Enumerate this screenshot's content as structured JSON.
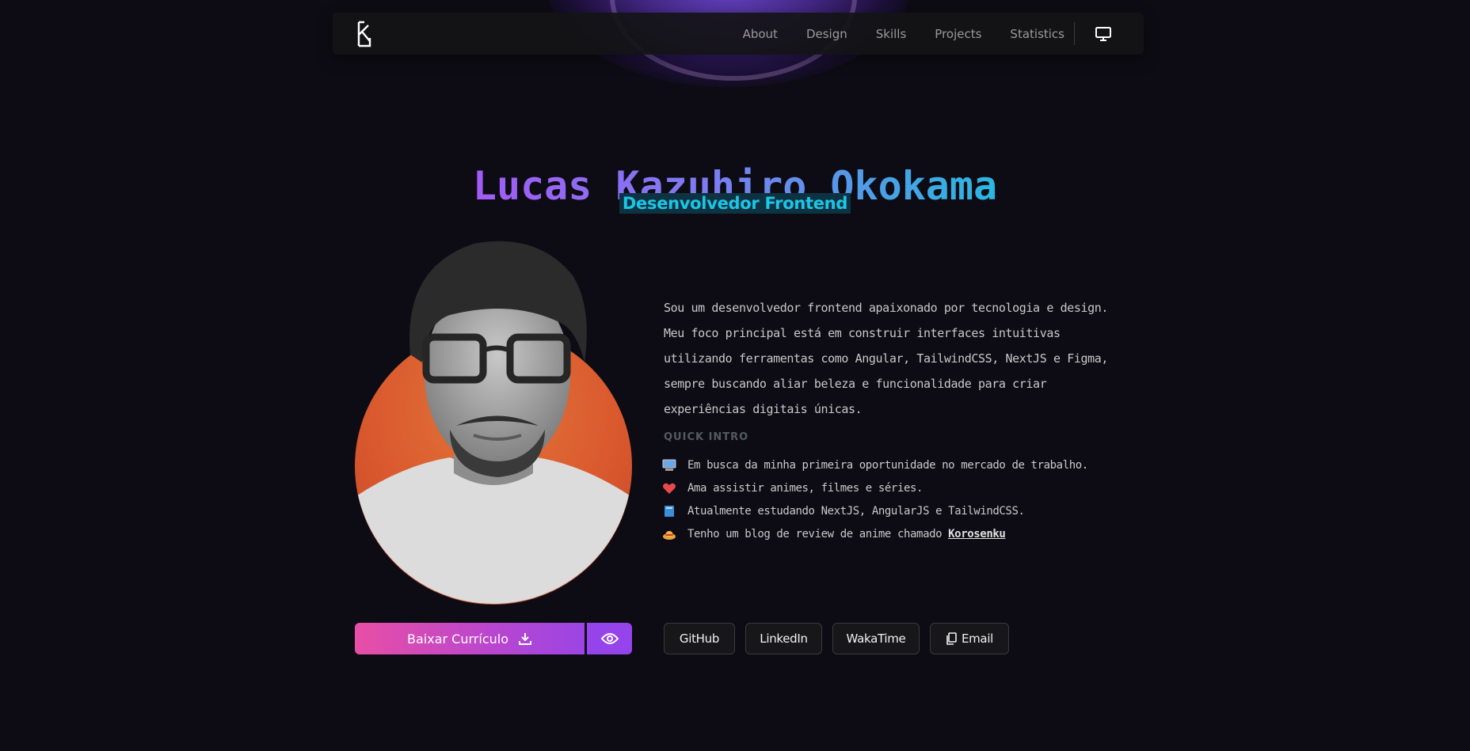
{
  "nav": {
    "links": [
      "About",
      "Design",
      "Skills",
      "Projects",
      "Statistics"
    ],
    "logo_icon": "k-logo-icon",
    "theme_icon": "monitor-icon"
  },
  "hero": {
    "name": "Lucas Kazuhiro Okokama",
    "role": "Desenvolvedor Frontend"
  },
  "about": {
    "bio": "Sou um desenvolvedor frontend apaixonado por tecnologia e design. Meu foco principal está em construir interfaces intuitivas utilizando ferramentas como Angular, TailwindCSS, NextJS e Figma, sempre buscando aliar beleza e funcionalidade para criar experiências digitais únicas.",
    "intro_title": "QUICK INTRO",
    "intro": [
      {
        "icon": "computer-icon",
        "text": "Em busca da minha primeira oportunidade no mercado de trabalho."
      },
      {
        "icon": "heart-icon",
        "text": "Ama assistir animes, filmes e séries."
      },
      {
        "icon": "book-icon",
        "text": "Atualmente estudando NextJS, AngularJS e TailwindCSS."
      },
      {
        "icon": "straw-hat-icon",
        "text": "Tenho um blog de review de anime chamado",
        "link": "Korosenku"
      }
    ]
  },
  "actions": {
    "cv_label": "Baixar Currículo",
    "social": [
      "GitHub",
      "LinkedIn",
      "WakaTime",
      "Email"
    ]
  },
  "colors": {
    "background": "#0d0c14",
    "accent_pink": "#e84fa5",
    "accent_purple": "#9444ea",
    "role_cyan": "#1cc6e6"
  }
}
